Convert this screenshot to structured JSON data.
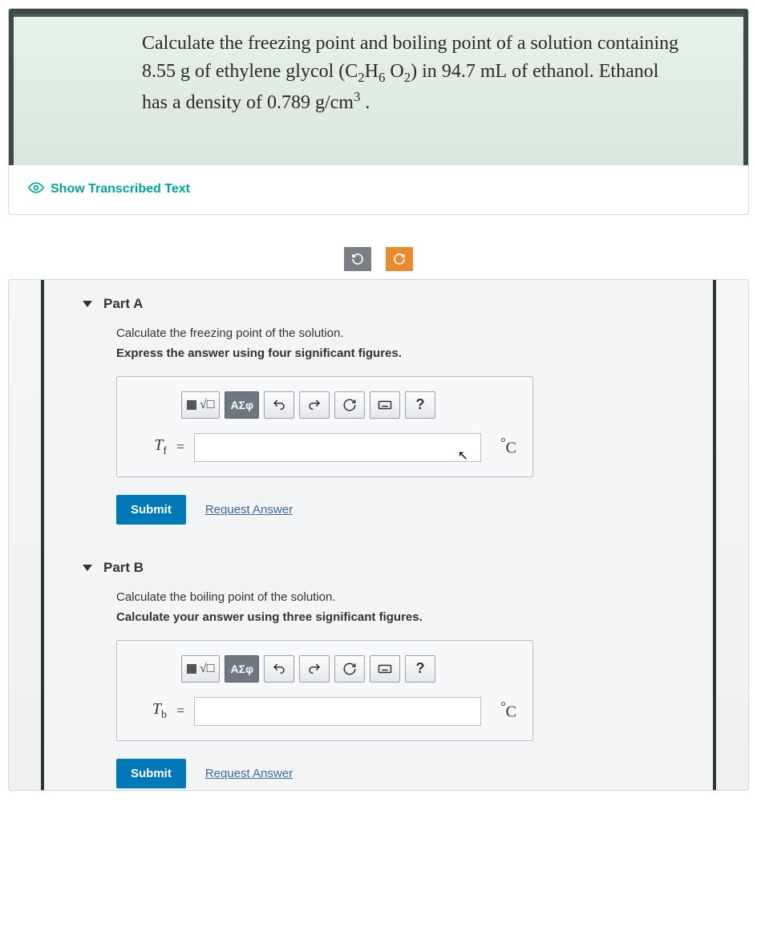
{
  "question": {
    "line1_prefix": "Calculate the freezing point and boiling point of a solution containing ",
    "mass": "8.55 g",
    "of_text": " of ethylene glycol ",
    "formula_open": "(C",
    "formula_sub1": "2",
    "formula_mid1": "H",
    "formula_sub2": "6",
    "formula_mid2": " O",
    "formula_sub3": "2",
    "formula_close": ")",
    "in_text": " in ",
    "volume": "94.7 mL",
    "solvent_text": " of ethanol. Ethanol has a density of ",
    "density": "0.789 g/cm",
    "density_sup": "3",
    "period": " ."
  },
  "show_transcribed": "Show Transcribed Text",
  "partA": {
    "title": "Part A",
    "instruction1": "Calculate the freezing point of the solution.",
    "instruction2": "Express the answer using four significant figures.",
    "var": "T",
    "var_sub": "f",
    "eq": "=",
    "unit_deg": "°",
    "unit_c": "C",
    "submit": "Submit",
    "request": "Request Answer"
  },
  "partB": {
    "title": "Part B",
    "instruction1": "Calculate the boiling point of the solution.",
    "instruction2": "Calculate your answer using three significant figures.",
    "var": "T",
    "var_sub": "b",
    "eq": "=",
    "unit_deg": "°",
    "unit_c": "C",
    "submit": "Submit",
    "request": "Request Answer"
  },
  "toolbar": {
    "greek": "ΑΣφ",
    "help": "?"
  }
}
